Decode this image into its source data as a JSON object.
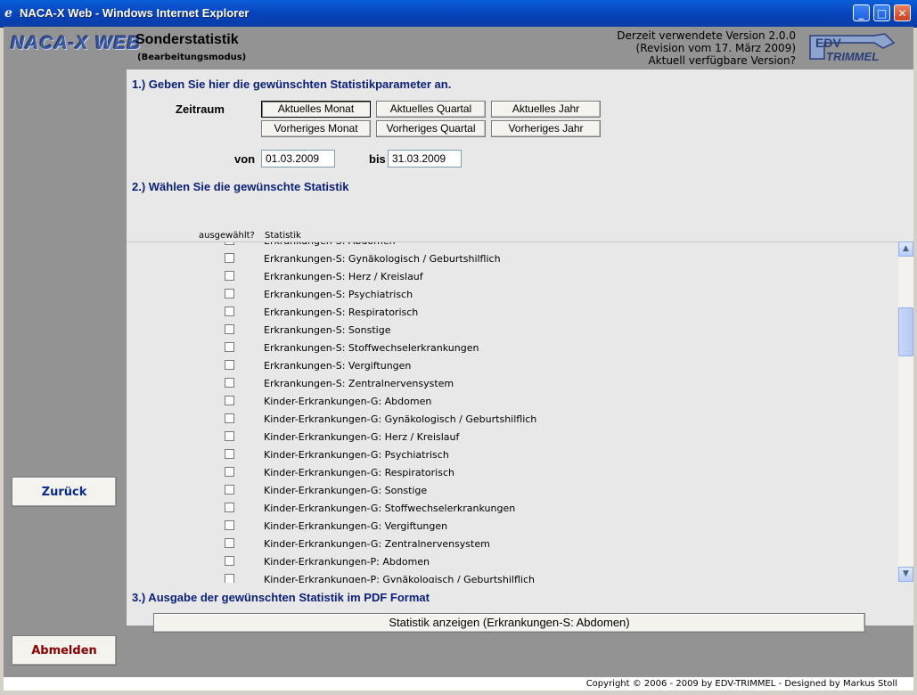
{
  "window": {
    "title": "NACA-X Web - Windows Internet Explorer",
    "icon": "ie-icon"
  },
  "header": {
    "logo": "NACA-X WEB",
    "title": "Sonderstatistik",
    "subtitle": "(Bearbeitungsmodus)",
    "version_line1": "Derzeit verwendete Version 2.0.0",
    "version_line2": "(Revision vom 17. März 2009)",
    "version_line3": "Aktuell verfügbare Version?",
    "edv_logo_text": "EDV",
    "edv_logo_sub": "TRIMMEL"
  },
  "sidebar": {
    "back_label": "Zurück",
    "logout_label": "Abmelden"
  },
  "step1": {
    "heading": "1.) Geben Sie hier die gewünschten Statistikparameter an.",
    "zeitraum_label": "Zeitraum",
    "buttons": [
      "Aktuelles Monat",
      "Aktuelles Quartal",
      "Aktuelles Jahr",
      "Vorheriges Monat",
      "Vorheriges Quartal",
      "Vorheriges Jahr"
    ],
    "active_button": "Aktuelles Monat",
    "von_label": "von",
    "von_value": "01.03.2009",
    "bis_label": "bis",
    "bis_value": "31.03.2009"
  },
  "step2": {
    "heading": "2.) Wählen Sie die gewünschte Statistik",
    "col_selected": "ausgewählt?",
    "col_statistik": "Statistik",
    "items": [
      {
        "label": "Erkrankungen-S: Abdomen",
        "checked": true
      },
      {
        "label": "Erkrankungen-S: Gynäkologisch / Geburtshilflich",
        "checked": false
      },
      {
        "label": "Erkrankungen-S: Herz / Kreislauf",
        "checked": false
      },
      {
        "label": "Erkrankungen-S: Psychiatrisch",
        "checked": false
      },
      {
        "label": "Erkrankungen-S: Respiratorisch",
        "checked": false
      },
      {
        "label": "Erkrankungen-S: Sonstige",
        "checked": false
      },
      {
        "label": "Erkrankungen-S: Stoffwechselerkrankungen",
        "checked": false
      },
      {
        "label": "Erkrankungen-S: Vergiftungen",
        "checked": false
      },
      {
        "label": "Erkrankungen-S: Zentralnervensystem",
        "checked": false
      },
      {
        "label": "Kinder-Erkrankungen-G: Abdomen",
        "checked": false
      },
      {
        "label": "Kinder-Erkrankungen-G: Gynäkologisch / Geburtshilflich",
        "checked": false
      },
      {
        "label": "Kinder-Erkrankungen-G: Herz / Kreislauf",
        "checked": false
      },
      {
        "label": "Kinder-Erkrankungen-G: Psychiatrisch",
        "checked": false
      },
      {
        "label": "Kinder-Erkrankungen-G: Respiratorisch",
        "checked": false
      },
      {
        "label": "Kinder-Erkrankungen-G: Sonstige",
        "checked": false
      },
      {
        "label": "Kinder-Erkrankungen-G: Stoffwechselerkrankungen",
        "checked": false
      },
      {
        "label": "Kinder-Erkrankungen-G: Vergiftungen",
        "checked": false
      },
      {
        "label": "Kinder-Erkrankungen-G: Zentralnervensystem",
        "checked": false
      },
      {
        "label": "Kinder-Erkrankungen-P: Abdomen",
        "checked": false
      },
      {
        "label": "Kinder-Erkrankungen-P: Gynäkologisch / Geburtshilflich",
        "checked": false
      }
    ]
  },
  "step3": {
    "heading": "3.) Ausgabe der gewünschten Statistik im PDF Format",
    "show_button": "Statistik anzeigen    (Erkrankungen-S: Abdomen)"
  },
  "footer": {
    "copyright": "Copyright © 2006 - 2009 by EDV-TRIMMEL - Designed by Markus Stoll"
  },
  "colors": {
    "title_bar": "#0a5fd9",
    "frame": "#939393",
    "content_bg": "#e8e8e8",
    "heading": "#0a1f7a",
    "logout": "#8a0000"
  }
}
